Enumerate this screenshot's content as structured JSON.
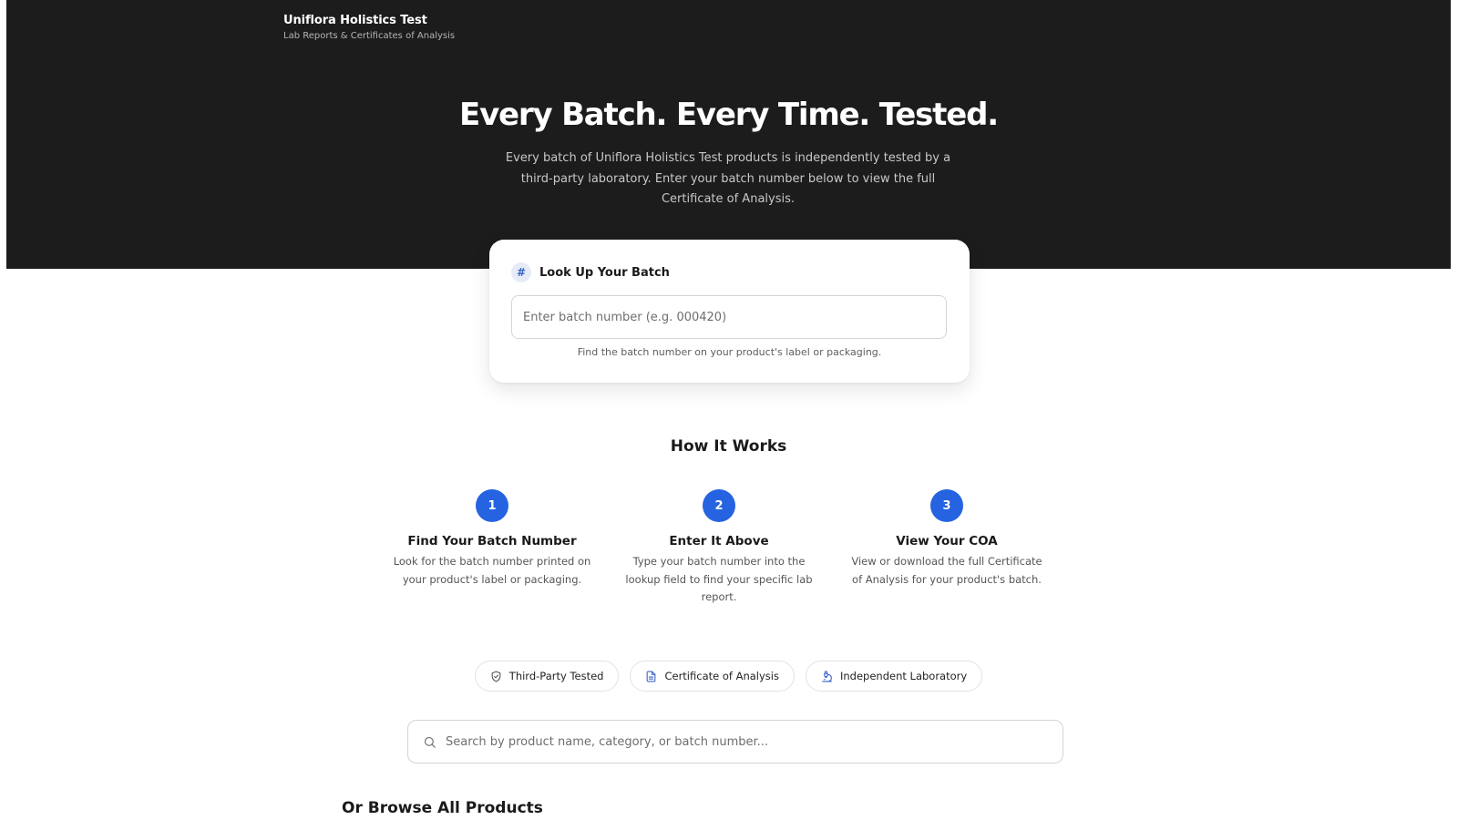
{
  "brand": {
    "name": "Uniflora Holistics Test",
    "subtitle": "Lab Reports & Certificates of Analysis"
  },
  "hero": {
    "title": "Every Batch. Every Time. Tested.",
    "description": "Every batch of Uniflora Holistics Test products is independently tested by a third-party laboratory. Enter your batch number below to view the full Certificate of Analysis."
  },
  "lookup": {
    "icon": "#",
    "title": "Look Up Your Batch",
    "placeholder": "Enter batch number (e.g. 000420)",
    "hint": "Find the batch number on your product's label or packaging."
  },
  "how_it_works": {
    "title": "How It Works",
    "steps": [
      {
        "number": "1",
        "title": "Find Your Batch Number",
        "description": "Look for the batch number printed on your product's label or packaging."
      },
      {
        "number": "2",
        "title": "Enter It Above",
        "description": "Type your batch number into the lookup field to find your specific lab report."
      },
      {
        "number": "3",
        "title": "View Your COA",
        "description": "View or download the full Certificate of Analysis for your product's batch."
      }
    ]
  },
  "badges": [
    {
      "label": "Third-Party Tested",
      "icon": "shield-check-icon"
    },
    {
      "label": "Certificate of Analysis",
      "icon": "document-icon"
    },
    {
      "label": "Independent Laboratory",
      "icon": "microscope-icon"
    }
  ],
  "search": {
    "placeholder": "Search by product name, category, or batch number..."
  },
  "browse": {
    "title": "Or Browse All Products"
  },
  "colors": {
    "hero_bg": "#1c1c1d",
    "accent": "#2563e0",
    "badge_icon_blue": "#3b63c9"
  }
}
